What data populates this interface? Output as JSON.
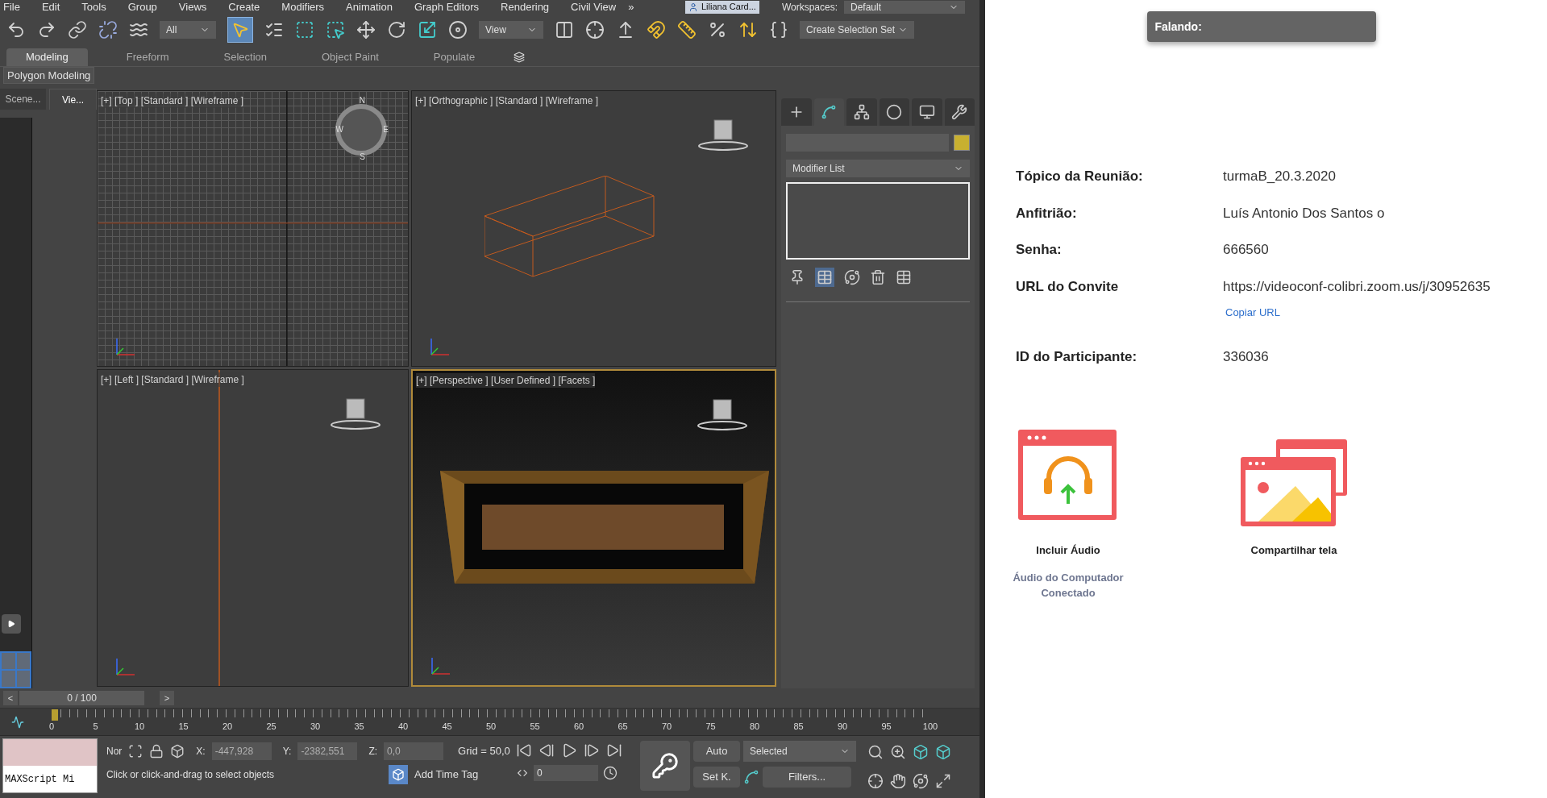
{
  "menu_bar": {
    "items": [
      "File",
      "Edit",
      "Tools",
      "Group",
      "Views",
      "Create",
      "Modifiers",
      "Animation",
      "Graph Editors",
      "Rendering",
      "Civil View"
    ],
    "overflow": "»",
    "user": "Liliana Card...",
    "workspaces_label": "Workspaces:",
    "workspace": "Default"
  },
  "main_toolbar": {
    "selection_filter": "All",
    "select_object_active": true,
    "reference_coordinate": "View",
    "selection_set": "Create Selection Set"
  },
  "ribbon": {
    "tabs": [
      {
        "label": "Modeling",
        "selected": true
      },
      {
        "label": "Freeform",
        "selected": false
      },
      {
        "label": "Selection",
        "selected": false
      },
      {
        "label": "Object Paint",
        "selected": false
      },
      {
        "label": "Populate",
        "selected": false
      }
    ],
    "panel": "Polygon Modeling"
  },
  "scene_explorer": {
    "tabs": [
      {
        "label": "Scene...",
        "selected": false
      },
      {
        "label": "Vie...",
        "selected": true
      }
    ]
  },
  "viewports": [
    {
      "kind": "grid",
      "label": "[+] [Top ] [Standard ] [Wireframe ]",
      "active": false,
      "compass": [
        "N",
        "W",
        "E",
        "S"
      ]
    },
    {
      "kind": "box",
      "label": "[+] [Orthographic ] [Standard ] [Wireframe ]",
      "active": false
    },
    {
      "kind": "line",
      "label": "[+] [Left ] [Standard ] [Wireframe ]",
      "active": false
    },
    {
      "kind": "render",
      "label": "[+] [Perspective ] [User Defined ] [Facets ]",
      "active": true
    }
  ],
  "command_panel": {
    "tabs": [
      {
        "selected": false
      },
      {
        "selected": true
      },
      {
        "selected": false
      },
      {
        "selected": false
      },
      {
        "selected": false
      },
      {
        "selected": false
      }
    ],
    "modifier_list": "Modifier List"
  },
  "time_slider": {
    "prev": "<",
    "reading": "0 / 100",
    "next": ">",
    "level": 0
  },
  "track_bar": {
    "ticks": [
      "0",
      "5",
      "10",
      "15",
      "20",
      "25",
      "30",
      "35",
      "40",
      "45",
      "50",
      "55",
      "60",
      "65",
      "70",
      "75",
      "80",
      "85",
      "90",
      "95",
      "100"
    ]
  },
  "status_bar": {
    "maxscript": "MAXScript Mi",
    "mode": "Nor",
    "coords": [
      {
        "axis": "X:",
        "value": "-447,928"
      },
      {
        "axis": "Y:",
        "value": "-2382,551"
      },
      {
        "axis": "Z:",
        "value": "0,0"
      }
    ],
    "grid": "Grid = 50,0",
    "prompt": "Click or click-and-drag to select objects",
    "add_time_tag": "Add Time Tag",
    "current_frame": "0",
    "auto_key": "Auto",
    "set_key": "Set K.",
    "key_filter": "Selected",
    "filters": "Filters..."
  },
  "zoom_panel": {
    "speaking": "Falando:",
    "info": [
      {
        "label": "Tópico da Reunião:",
        "value": "turmaB_20.3.2020"
      },
      {
        "label": "Anfitrião:",
        "value": "Luís Antonio Dos Santos o"
      },
      {
        "label": "Senha:",
        "value": "666560"
      },
      {
        "label": "URL do Convite",
        "value": "https://videoconf-colibri.zoom.us/j/30952635",
        "link": "Copiar URL"
      },
      {
        "label": "ID do Participante:",
        "value": "336036"
      }
    ],
    "actions": [
      {
        "kind": "audio",
        "label": "Incluir Áudio",
        "status": "Áudio do Computador Conectado"
      },
      {
        "kind": "share",
        "label": "Compartilhar tela"
      }
    ]
  }
}
